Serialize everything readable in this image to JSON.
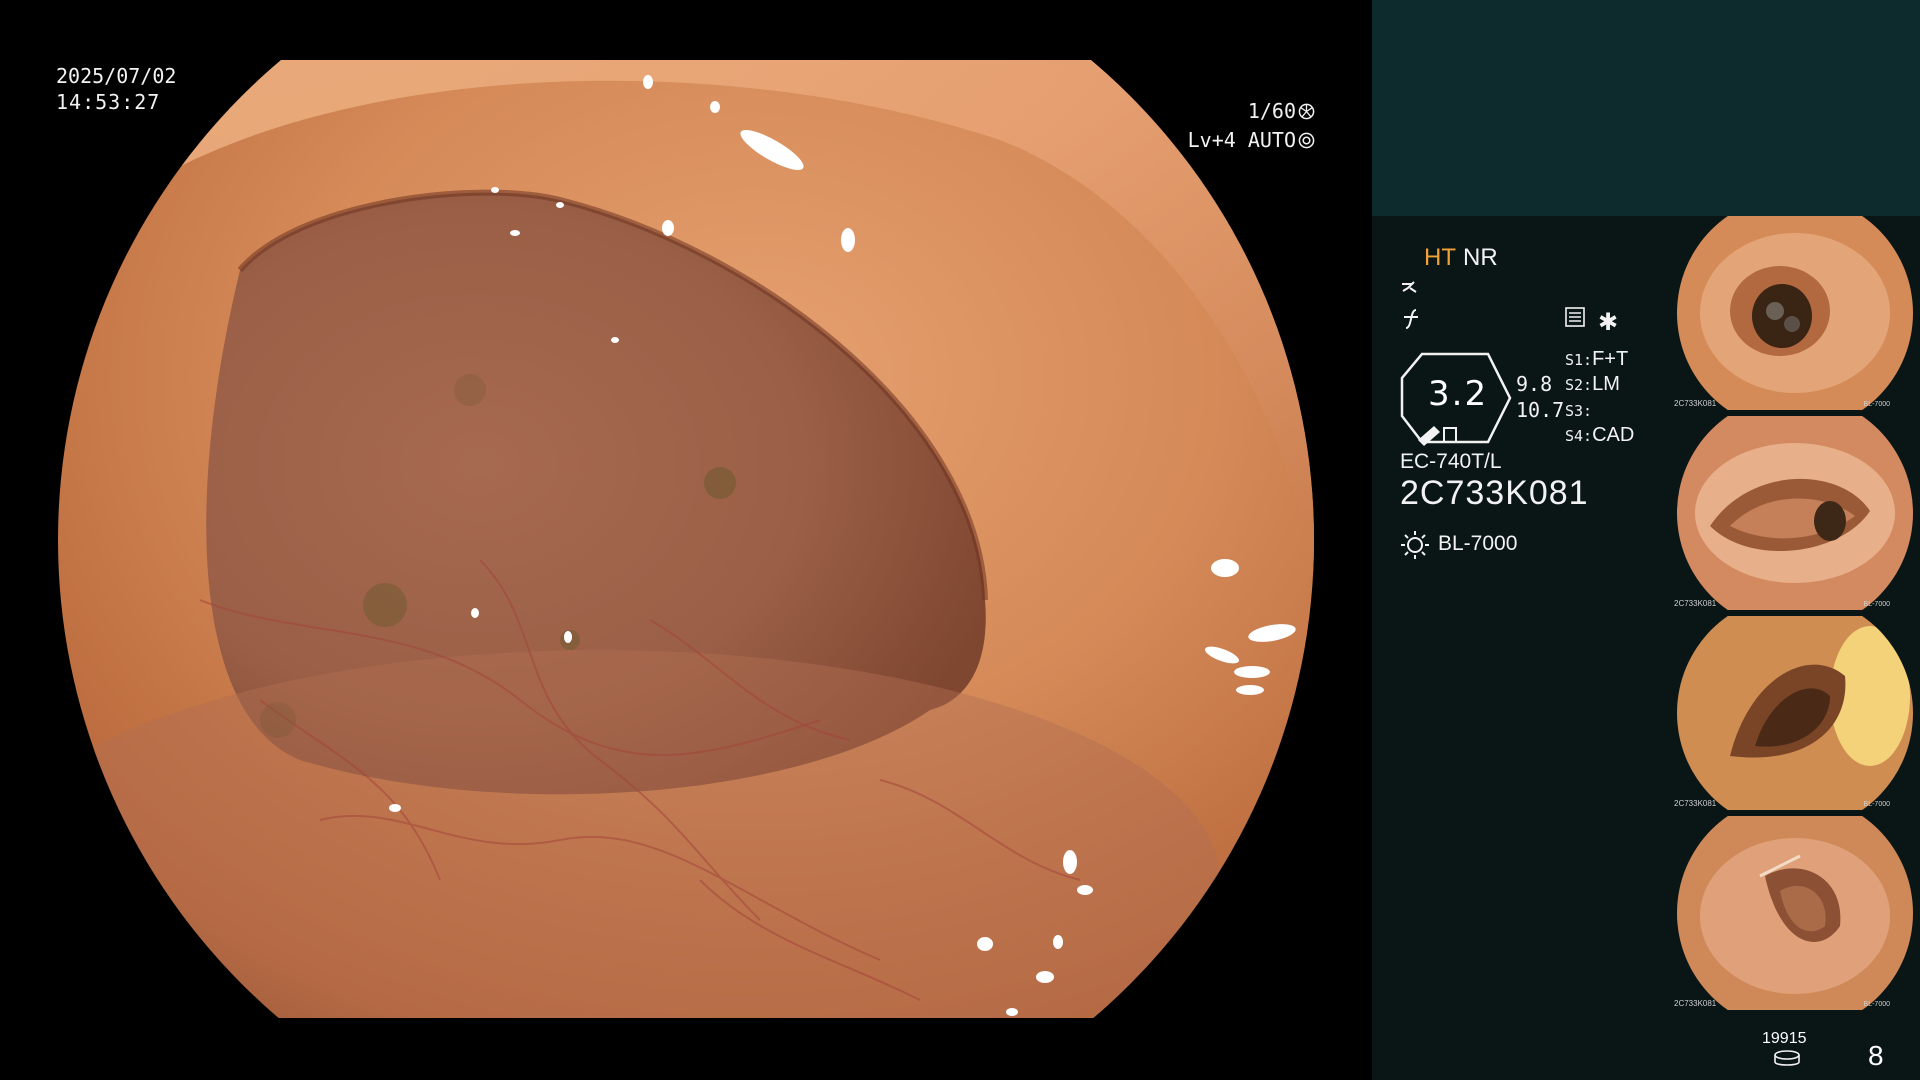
{
  "image": {
    "date": "2025/07/02",
    "time": "14:53:27"
  },
  "camera": {
    "shutter": "1/60",
    "level": "Lv+4 AUTO"
  },
  "status": {
    "ht": "HT",
    "nr": "NR",
    "zoom": "3.2",
    "aperture_1": "9.8",
    "aperture_2": "10.7",
    "switches": [
      {
        "key": "S1:",
        "value": "F+T"
      },
      {
        "key": "S2:",
        "value": "LM"
      },
      {
        "key": "S3:",
        "value": ""
      },
      {
        "key": "S4:",
        "value": "CAD"
      }
    ],
    "scope_model": "EC-740T/L",
    "scope_serial": "2C733K081",
    "light_source": "BL-7000",
    "icons": [
      "freeze-icon",
      "enhance-icon",
      "structure-icon",
      "asterisk-icon",
      "zoom-icon",
      "light-source-icon",
      "storage-icon"
    ]
  },
  "thumbnails": [
    {
      "id": "2C733K081",
      "model": "BL-7000"
    },
    {
      "id": "2C733K081",
      "model": "BL-7000"
    },
    {
      "id": "2C733K081",
      "model": "BL-7000"
    },
    {
      "id": "2C733K081",
      "model": "BL-7000"
    }
  ],
  "storage": {
    "count": "19915"
  },
  "page_count": "8",
  "colors": {
    "highlight": "#f0a13a",
    "panel_bg": "#0a1516",
    "panel_top": "#0d2a2d",
    "tissue": "#c97a4e"
  }
}
